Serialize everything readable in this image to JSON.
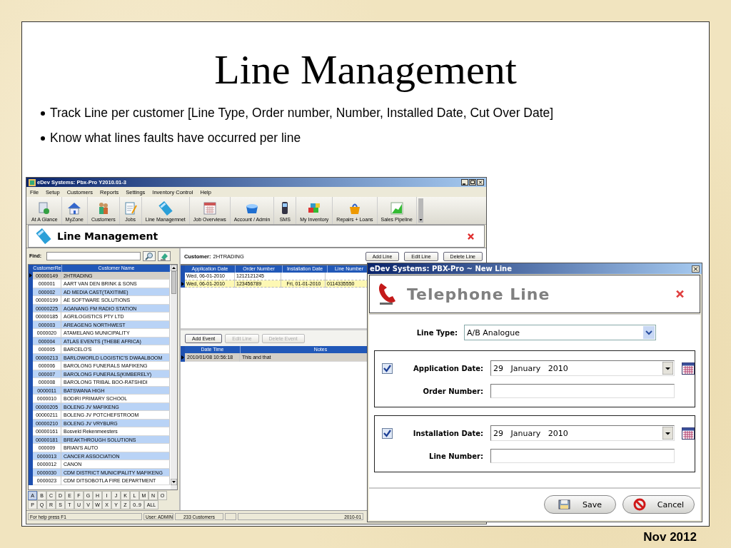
{
  "slide": {
    "title": "Line Management",
    "bullets": [
      "Track Line per customer [Line Type, Order number, Number, Installed Date, Cut Over Date]",
      "Know what lines faults have occurred per line"
    ],
    "footer": "Nov 2012"
  },
  "app_window": {
    "title": "eDev Systems: Pbx-Pro Y2010.01-3",
    "menu": [
      "File",
      "Setup",
      "Customers",
      "Reports",
      "Settings",
      "Inventory Control",
      "Help"
    ],
    "toolbar": [
      "At A Glance",
      "MyZone",
      "Customers",
      "Jobs",
      "Line Managemnet",
      "Job Overviews",
      "Account / Admin",
      "SMS",
      "My Inventory",
      "Repairs + Loans",
      "Sales Pipeline"
    ],
    "header": "Line Management",
    "find_label": "Find:",
    "customer_grid": {
      "columns": [
        "CustomerRe",
        "Customer Name"
      ],
      "rows": [
        {
          "cells": [
            "00000149",
            "2HTRADING"
          ],
          "selected": true
        },
        {
          "cells": [
            "000001",
            "AART VAN DEN  BRINK & SONS"
          ],
          "selected": false
        },
        {
          "cells": [
            "000002",
            "AD MEDIA CAST(TAXITIME)"
          ],
          "selected": false
        },
        {
          "cells": [
            "00000199",
            "AE SOFTWARE SOLUTIONS"
          ],
          "selected": false
        },
        {
          "cells": [
            "00000225",
            "AGANANG FM RADIO STATION"
          ],
          "selected": false
        },
        {
          "cells": [
            "00000185",
            "AGRILOGISTICS PTY LTD"
          ],
          "selected": false
        },
        {
          "cells": [
            "000003",
            "AREAGENG NORTHWEST"
          ],
          "selected": false
        },
        {
          "cells": [
            "0000020",
            "ATAMELANG MUNICIPALITY"
          ],
          "selected": false
        },
        {
          "cells": [
            "000004",
            "ATLAS EVENTS (THEBE AFRICA)"
          ],
          "selected": false
        },
        {
          "cells": [
            "000005",
            "BARCELO'S"
          ],
          "selected": false
        },
        {
          "cells": [
            "00000213",
            "BARLOWORLD LOGISTIC'S DWAALBOOM"
          ],
          "selected": false
        },
        {
          "cells": [
            "000006",
            "BAROLONG FUNERALS MAFIKENG"
          ],
          "selected": false
        },
        {
          "cells": [
            "000007",
            "BAROLONG FUNERALS(KIMBERELY)"
          ],
          "selected": false
        },
        {
          "cells": [
            "000008",
            "BAROLONG TRIBAL BOO-RATSHIDI"
          ],
          "selected": false
        },
        {
          "cells": [
            "0000011",
            "BATSWANA HIGH"
          ],
          "selected": false
        },
        {
          "cells": [
            "0000010",
            "BODIRI PRIMARY SCHOOL"
          ],
          "selected": false
        },
        {
          "cells": [
            "00000205",
            "BOLENG JV MAFIKENG"
          ],
          "selected": false
        },
        {
          "cells": [
            "00000211",
            "BOLENG JV POTCHEFSTROOM"
          ],
          "selected": false
        },
        {
          "cells": [
            "00000210",
            "BOLENG JV VRYBURG"
          ],
          "selected": false
        },
        {
          "cells": [
            "00000161",
            "Bosveld Rekenmeesters"
          ],
          "selected": false
        },
        {
          "cells": [
            "00000181",
            "BREAKTHROUGH SOLUTIONS"
          ],
          "selected": false
        },
        {
          "cells": [
            "000009",
            "BRIAN'S AUTO"
          ],
          "selected": false
        },
        {
          "cells": [
            "0000013",
            "CANCER ASSOCIATION"
          ],
          "selected": false
        },
        {
          "cells": [
            "0000012",
            "CANON"
          ],
          "selected": false
        },
        {
          "cells": [
            "0000030",
            "CDM DISTRICT MUNICIPALITY MAFIKENG"
          ],
          "selected": false
        },
        {
          "cells": [
            "0000023",
            "CDM DITSOBOTLA FIRE DEPARTMENT"
          ],
          "selected": false
        }
      ]
    },
    "alphabet": [
      [
        {
          "label": "A",
          "selected": true
        },
        {
          "label": "B",
          "selected": false
        },
        {
          "label": "C",
          "selected": false
        },
        {
          "label": "D",
          "selected": false
        },
        {
          "label": "E",
          "selected": false
        },
        {
          "label": "F",
          "selected": false
        },
        {
          "label": "G",
          "selected": false
        },
        {
          "label": "H",
          "selected": false
        },
        {
          "label": "I",
          "selected": false
        },
        {
          "label": "J",
          "selected": false
        },
        {
          "label": "K",
          "selected": false
        },
        {
          "label": "L",
          "selected": false
        },
        {
          "label": "M",
          "selected": false
        },
        {
          "label": "N",
          "selected": false
        },
        {
          "label": "O",
          "selected": false
        }
      ],
      [
        {
          "label": "P",
          "selected": false
        },
        {
          "label": "Q",
          "selected": false
        },
        {
          "label": "R",
          "selected": false
        },
        {
          "label": "S",
          "selected": false
        },
        {
          "label": "T",
          "selected": false
        },
        {
          "label": "U",
          "selected": false
        },
        {
          "label": "V",
          "selected": false
        },
        {
          "label": "W",
          "selected": false
        },
        {
          "label": "X",
          "selected": false
        },
        {
          "label": "Y",
          "selected": false
        },
        {
          "label": "Z",
          "selected": false
        },
        {
          "label": "0..9",
          "selected": false
        },
        {
          "label": "ALL",
          "selected": false
        }
      ]
    ],
    "customer_label": "Customer:",
    "customer_value": "2HTRADING",
    "line_buttons": [
      "Add Line",
      "Edit Line",
      "Delete Line"
    ],
    "lines_grid": {
      "columns": [
        "Application Date",
        "Order Number",
        "Installation Date",
        "Line Number"
      ],
      "rows": [
        {
          "cells": [
            "Wed, 06-01-2010",
            "1212121245",
            null,
            null
          ],
          "selected": false
        },
        {
          "cells": [
            "Wed, 06-01-2010",
            "123456789",
            "Fri, 01-01-2010",
            "0114335550"
          ],
          "selected": true
        }
      ]
    },
    "event_buttons": [
      {
        "label": "Add Event",
        "disabled": false
      },
      {
        "label": "Edit Line",
        "disabled": true
      },
      {
        "label": "Delete Event",
        "disabled": true
      }
    ],
    "events_grid": {
      "columns": [
        "Date Time",
        "Notes"
      ],
      "rows": [
        {
          "cells": [
            "2010/01/08 10:56:18",
            "This and that"
          ],
          "selected": true
        }
      ]
    },
    "status_bar": [
      "For help press F1",
      "User: ADMIN",
      "233 Customers",
      "2010-01"
    ]
  },
  "dialog": {
    "title": "eDev Systems: PBX-Pro ~ New Line",
    "header": "Telephone Line",
    "line_type": {
      "label": "Line Type:",
      "value": "A/B Analogue"
    },
    "groups": [
      {
        "date_label": "Application Date:",
        "checked": true,
        "date_value": "29   January   2010",
        "field_label": "Order Number:"
      },
      {
        "date_label": "Installation Date:",
        "checked": true,
        "date_value": "29   January   2010",
        "field_label": "Line Number:"
      }
    ],
    "buttons": [
      {
        "label": "Save",
        "kind": "save"
      },
      {
        "label": "Cancel",
        "kind": "cancel"
      }
    ]
  }
}
